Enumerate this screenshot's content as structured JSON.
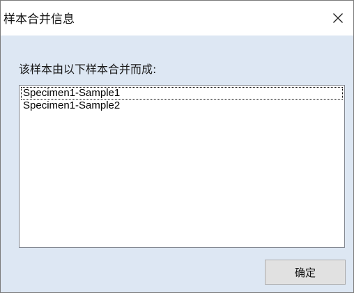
{
  "window": {
    "title": "样本合并信息",
    "close_icon": "close-icon"
  },
  "prompt": "该样本由以下样本合并而成:",
  "list": {
    "items": [
      "Specimen1-Sample1",
      "Specimen1-Sample2"
    ],
    "focused_index": 0
  },
  "buttons": {
    "ok_label": "确定"
  },
  "colors": {
    "dialog_background": "#dde7f3",
    "titlebar_background": "#ffffff",
    "button_background": "#e1e1e1"
  }
}
